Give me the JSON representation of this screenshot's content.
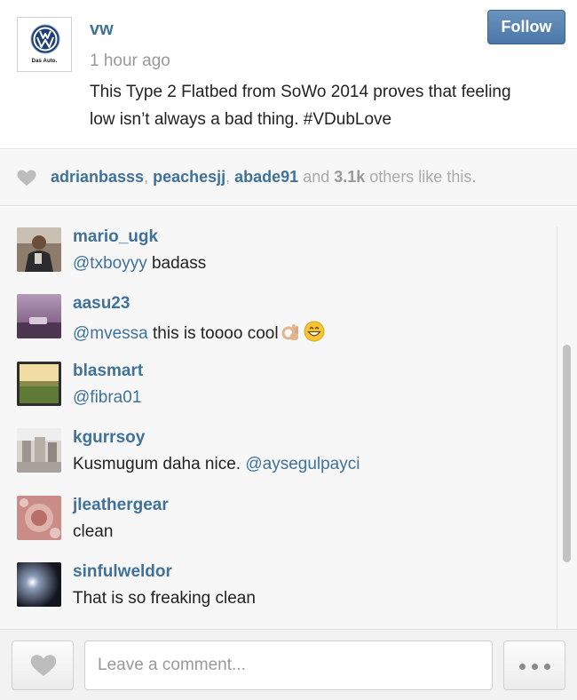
{
  "post": {
    "username": "vw",
    "time_ago": "1 hour ago",
    "caption": "This Type 2 Flatbed from SoWo 2014 proves that feeling low isn’t always a bad thing. #VDubLove",
    "avatar_tagline": "Das Auto.",
    "avatar_logo": "volkswagen-logo",
    "follow_label": "Follow"
  },
  "likes": {
    "icon": "heart-icon",
    "users": [
      "adrianbasss",
      "peachesjj",
      "abade91"
    ],
    "sep1": ", ",
    "sep2": ", ",
    "and": " and ",
    "count": "3.1k",
    "suffix": " others like this."
  },
  "comments": [
    {
      "user": "mario_ugk",
      "mention": "@txboyyy",
      "text": " badass",
      "avatar": "photo-avatar"
    },
    {
      "user": "aasu23",
      "mention": "@mvessa",
      "text": " this is toooo cool",
      "avatar": "photo-avatar",
      "emojis": [
        "ok-hand-emoji",
        "grinning-face-emoji"
      ]
    },
    {
      "user": "blasmart",
      "mention": "@fibra01",
      "text": "",
      "avatar": "photo-avatar"
    },
    {
      "user": "kgurrsoy",
      "text": "Kusmugum daha nice. ",
      "mention": "@aysegulpayci",
      "avatar": "photo-avatar"
    },
    {
      "user": "jleathergear",
      "text": "clean",
      "avatar": "photo-avatar"
    },
    {
      "user": "sinfulweldor",
      "text": "That is so freaking clean",
      "avatar": "photo-avatar"
    }
  ],
  "footer": {
    "like_icon": "heart-icon",
    "comment_placeholder": "Leave a comment...",
    "more_icon": "more-dots-icon"
  },
  "colors": {
    "link_blue": "#3f729b",
    "follow_button": "#4a76a8",
    "muted_text": "#999999",
    "panel_background": "#f7f7f7"
  }
}
